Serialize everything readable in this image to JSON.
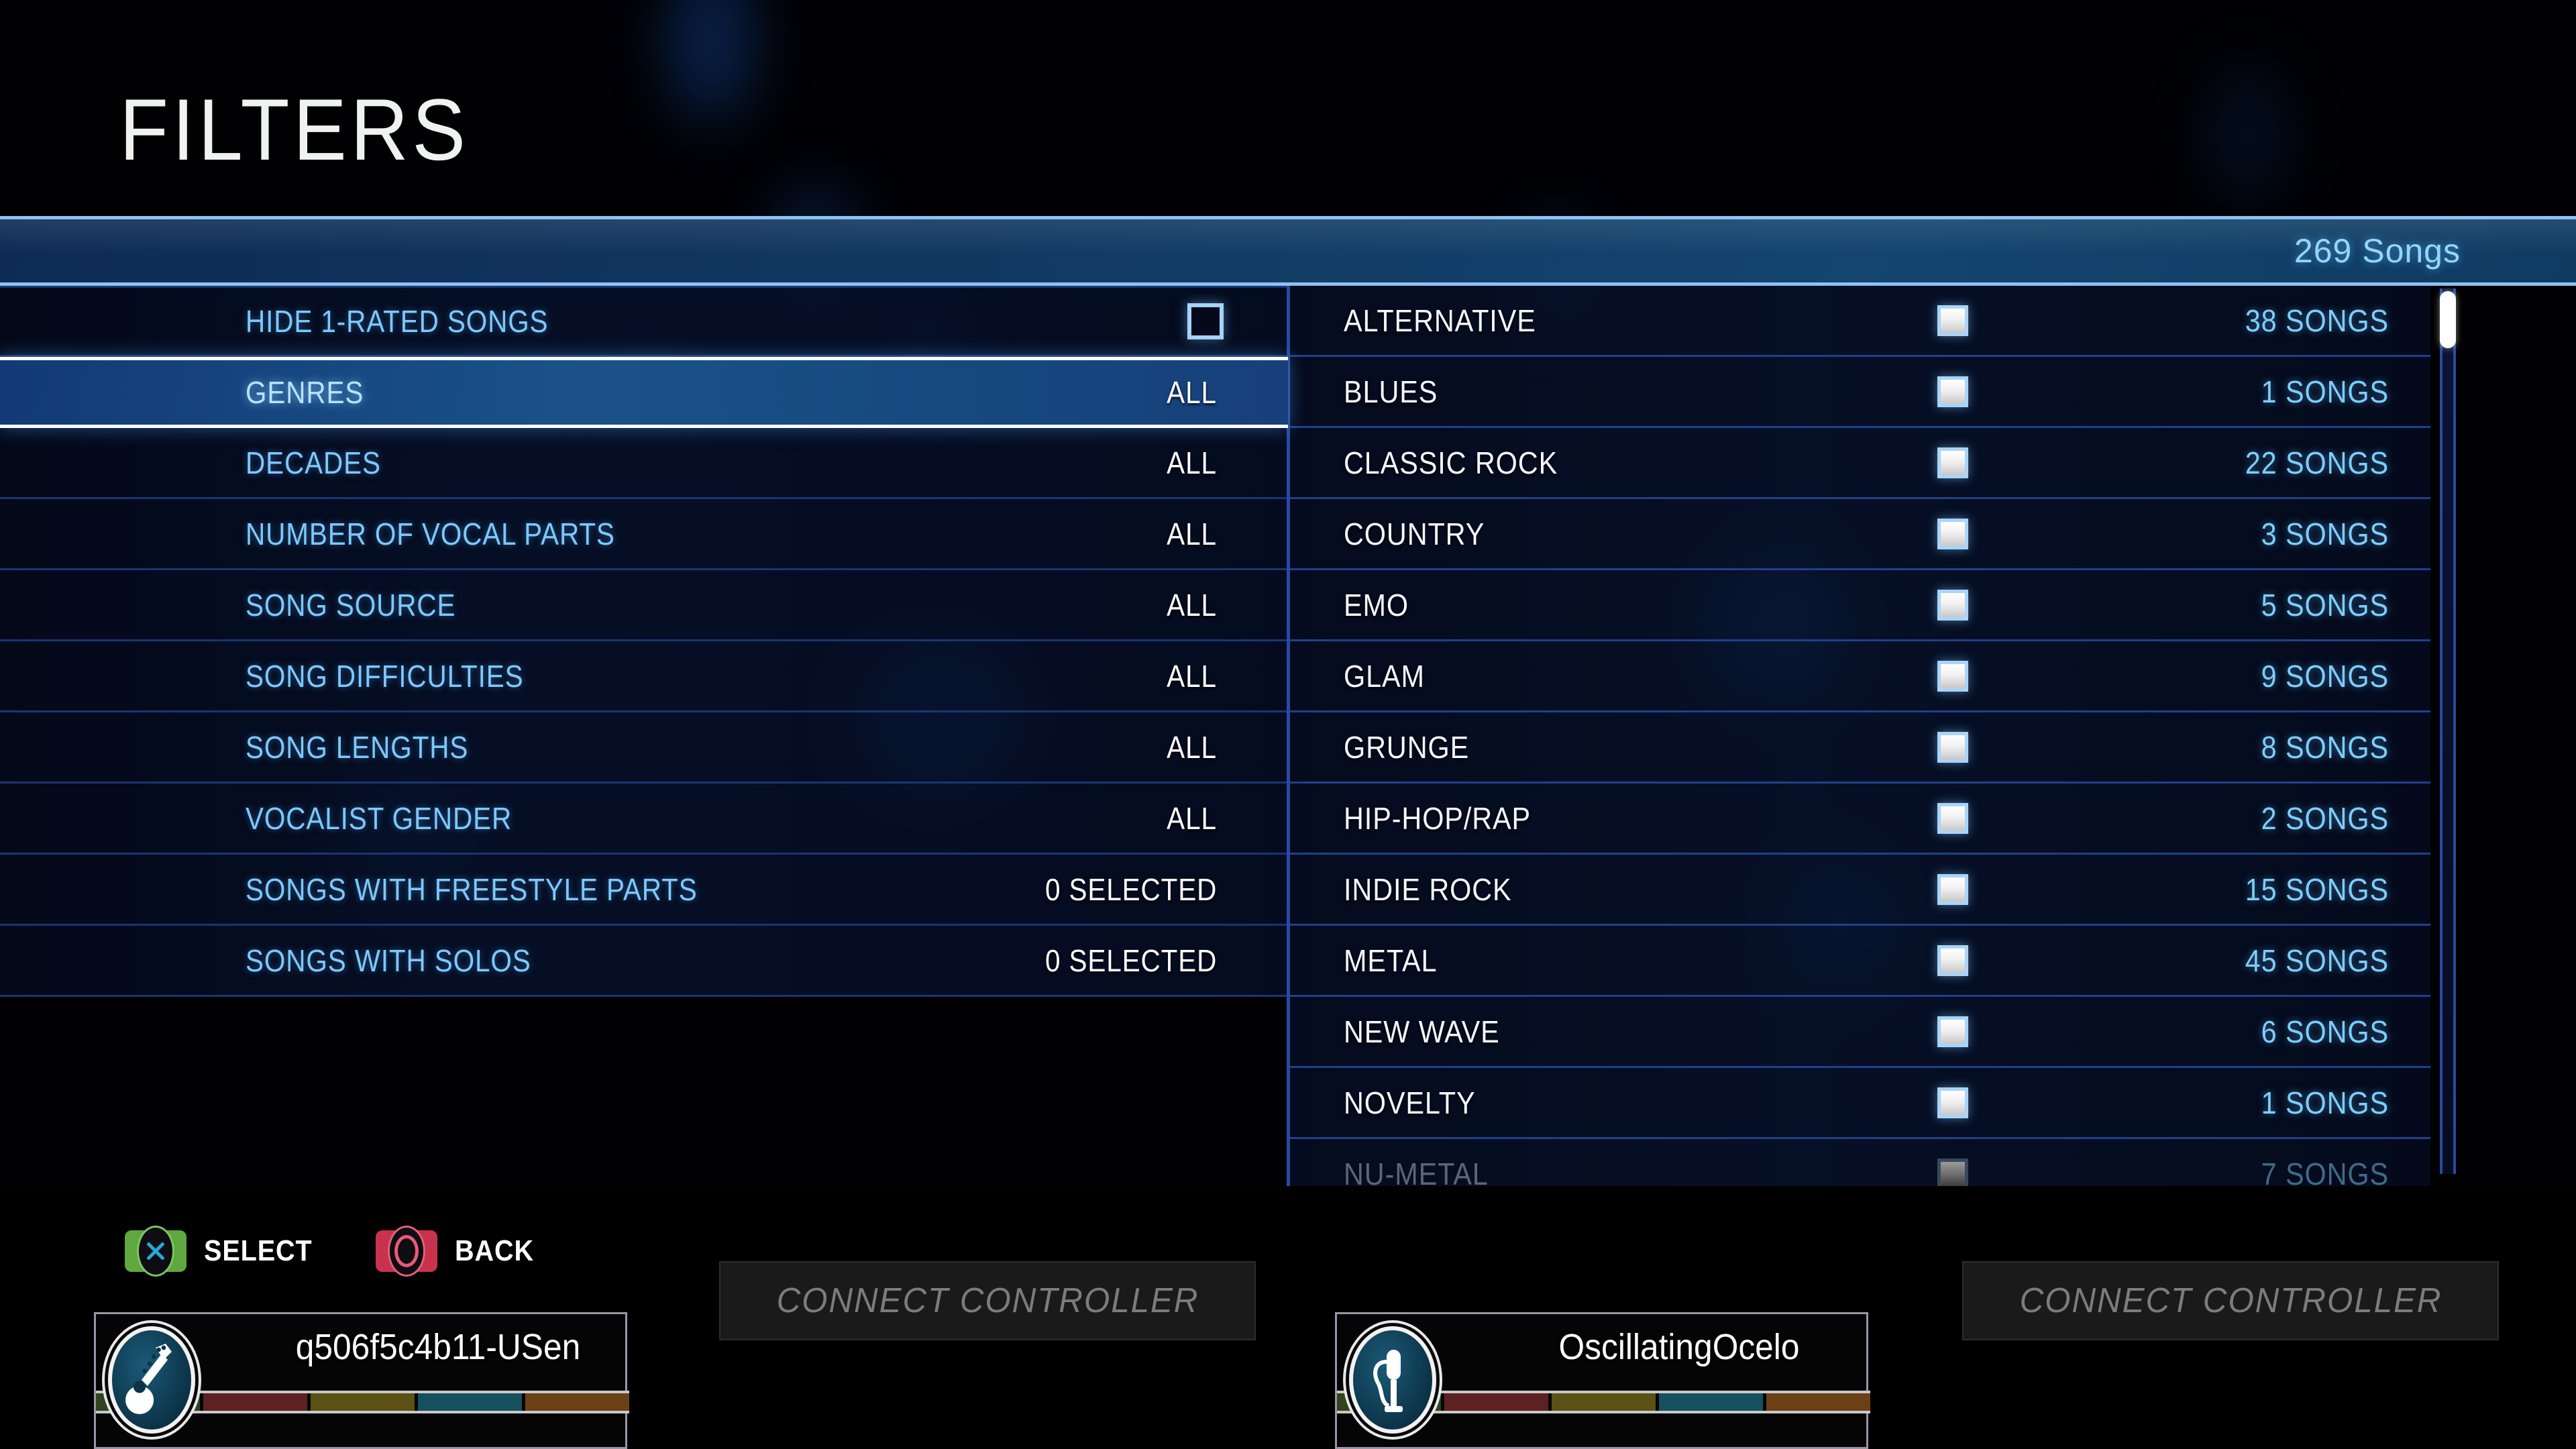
{
  "header": {
    "title": "FILTERS",
    "song_count": "269 Songs"
  },
  "filters": {
    "rows": [
      {
        "label": "HIDE 1-RATED SONGS",
        "value": "",
        "control": "checkbox",
        "checked": false,
        "selected": false
      },
      {
        "label": "GENRES",
        "value": "ALL",
        "control": "value",
        "selected": true
      },
      {
        "label": "DECADES",
        "value": "ALL",
        "control": "value",
        "selected": false
      },
      {
        "label": "NUMBER OF VOCAL PARTS",
        "value": "ALL",
        "control": "value",
        "selected": false
      },
      {
        "label": "SONG SOURCE",
        "value": "ALL",
        "control": "value",
        "selected": false
      },
      {
        "label": "SONG DIFFICULTIES",
        "value": "ALL",
        "control": "value",
        "selected": false
      },
      {
        "label": "SONG LENGTHS",
        "value": "ALL",
        "control": "value",
        "selected": false
      },
      {
        "label": "VOCALIST GENDER",
        "value": "ALL",
        "control": "value",
        "selected": false
      },
      {
        "label": "SONGS WITH FREESTYLE PARTS",
        "value": "0 SELECTED",
        "control": "value",
        "selected": false
      },
      {
        "label": "SONGS WITH SOLOS",
        "value": "0 SELECTED",
        "control": "value",
        "selected": false
      }
    ]
  },
  "genres": {
    "rows": [
      {
        "name": "ALTERNATIVE",
        "count": "38 SONGS",
        "checked": true,
        "faded": false
      },
      {
        "name": "BLUES",
        "count": "1 SONGS",
        "checked": true,
        "faded": false
      },
      {
        "name": "CLASSIC ROCK",
        "count": "22 SONGS",
        "checked": true,
        "faded": false
      },
      {
        "name": "COUNTRY",
        "count": "3 SONGS",
        "checked": true,
        "faded": false
      },
      {
        "name": "EMO",
        "count": "5 SONGS",
        "checked": true,
        "faded": false
      },
      {
        "name": "GLAM",
        "count": "9 SONGS",
        "checked": true,
        "faded": false
      },
      {
        "name": "GRUNGE",
        "count": "8 SONGS",
        "checked": true,
        "faded": false
      },
      {
        "name": "HIP-HOP/RAP",
        "count": "2 SONGS",
        "checked": true,
        "faded": false
      },
      {
        "name": "INDIE ROCK",
        "count": "15 SONGS",
        "checked": true,
        "faded": false
      },
      {
        "name": "METAL",
        "count": "45 SONGS",
        "checked": true,
        "faded": false
      },
      {
        "name": "NEW WAVE",
        "count": "6 SONGS",
        "checked": true,
        "faded": false
      },
      {
        "name": "NOVELTY",
        "count": "1 SONGS",
        "checked": true,
        "faded": false
      },
      {
        "name": "NU-METAL",
        "count": "7 SONGS",
        "checked": true,
        "faded": true
      }
    ]
  },
  "prompts": [
    {
      "icon": "cross-button-icon",
      "button": "X",
      "label": "SELECT",
      "color": "#5fa83f"
    },
    {
      "icon": "circle-button-icon",
      "button": "O",
      "label": "BACK",
      "color": "#c9324d"
    }
  ],
  "players": [
    {
      "name": "q506f5c4b11-USen",
      "icon": "guitar-icon",
      "segments": [
        "#2f441f",
        "#5d2121",
        "#5c5115",
        "#16505f",
        "#6b4016"
      ]
    },
    {
      "name": "OscillatingOcelo",
      "icon": "microphone-icon",
      "segments": [
        "#2f441f",
        "#5d2121",
        "#5c5115",
        "#16505f",
        "#6b4016"
      ]
    }
  ],
  "connect_slots": [
    {
      "label": "CONNECT CONTROLLER"
    },
    {
      "label": "CONNECT CONTROLLER"
    }
  ],
  "colors": {
    "accent_blue": "#7ec8f8",
    "count_blue": "#8fd8fb",
    "selected_row": "#1a5288",
    "divider": "#2a4aa0",
    "white": "#ffffff"
  }
}
